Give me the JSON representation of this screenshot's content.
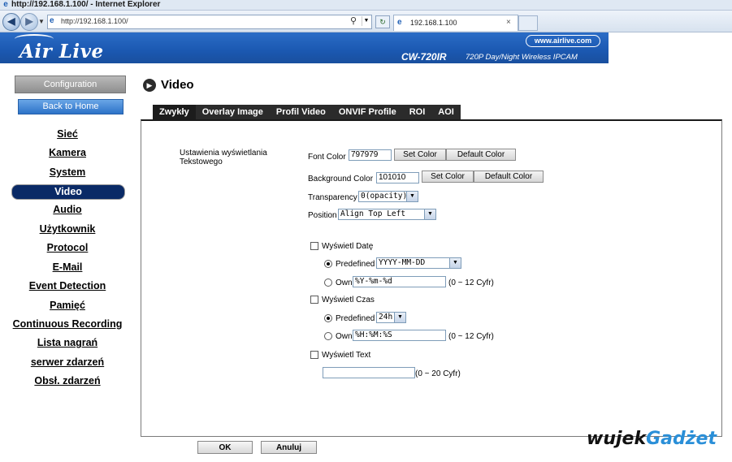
{
  "window": {
    "title": "http://192.168.1.100/ - Internet Explorer"
  },
  "browser": {
    "url": "http://192.168.1.100/",
    "tab_title": "192.168.1.100",
    "tab_close": "×"
  },
  "banner": {
    "logo": "Air Live",
    "website": "www.airlive.com",
    "model": "CW-720IR",
    "model_desc": "720P Day/Night Wireless IPCAM"
  },
  "sidebar": {
    "configuration": "Configuration",
    "back_to_home": "Back to Home",
    "items": [
      {
        "label": "Sieć"
      },
      {
        "label": "Kamera"
      },
      {
        "label": "System"
      },
      {
        "label": "Video",
        "active": true
      },
      {
        "label": "Audio"
      },
      {
        "label": "Użytkownik"
      },
      {
        "label": "Protocol"
      },
      {
        "label": "E-Mail"
      },
      {
        "label": "Event Detection"
      },
      {
        "label": "Pamięć"
      },
      {
        "label": "Continuous Recording"
      },
      {
        "label": "Lista nagrań"
      },
      {
        "label": "serwer zdarzeń"
      },
      {
        "label": "Obsł. zdarzeń"
      }
    ]
  },
  "page": {
    "title": "Video"
  },
  "tabs": [
    {
      "label": "Zwykły",
      "active": true
    },
    {
      "label": "Overlay Image"
    },
    {
      "label": "Profil Video"
    },
    {
      "label": "ONVIF Profile"
    },
    {
      "label": "ROI"
    },
    {
      "label": "AOI"
    }
  ],
  "form": {
    "section_label": "Ustawienia wyświetlania Tekstowego",
    "font_color": {
      "label": "Font Color",
      "value": "797979",
      "set": "Set Color",
      "default": "Default Color"
    },
    "background_color": {
      "label": "Background Color",
      "value": "101010",
      "set": "Set Color",
      "default": "Default Color"
    },
    "transparency": {
      "label": "Transparency",
      "value": "0(opacity)"
    },
    "position": {
      "label": "Position",
      "value": "Align Top Left"
    },
    "show_date": {
      "label": "Wyświetl Datę",
      "checked": false,
      "predefined_label": "Predefined",
      "predefined_value": "YYYY-MM-DD",
      "predefined_selected": true,
      "own_label": "Own",
      "own_value": "%Y-%m-%d",
      "own_hint": "(0 ~ 12 Cyfr)"
    },
    "show_time": {
      "label": "Wyświetl Czas",
      "checked": false,
      "predefined_label": "Predefined",
      "predefined_value": "24h",
      "predefined_selected": true,
      "own_label": "Own",
      "own_value": "%H:%M:%S",
      "own_hint": "(0 ~ 12 Cyfr)"
    },
    "show_text": {
      "label": "Wyświetl Text",
      "checked": false,
      "value": "",
      "hint": "(0 ~ 20 Cyfr)"
    }
  },
  "buttons": {
    "ok": "OK",
    "cancel": "Anuluj"
  },
  "watermark": {
    "part1": "wujek",
    "part2": "Gadżet"
  }
}
